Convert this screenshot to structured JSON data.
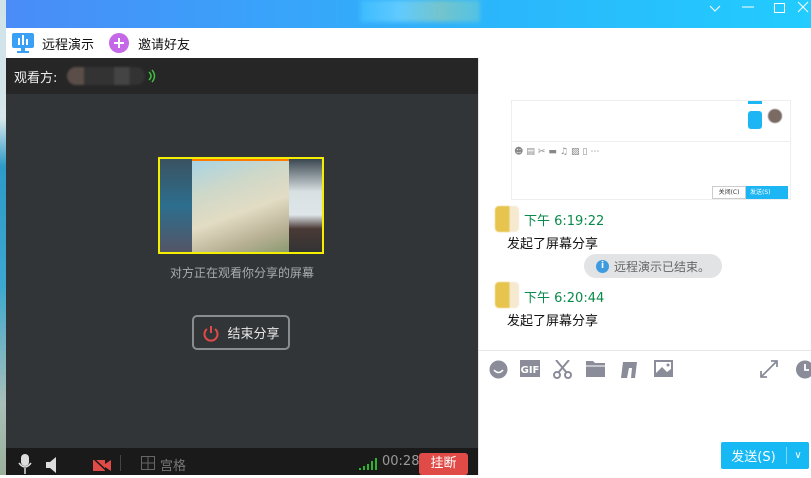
{
  "toolbar": {
    "remote_demo": "远程演示",
    "invite_friends": "邀请好友"
  },
  "call": {
    "viewer_label": "观看方:",
    "sharing_status": "对方正在观看你分享的屏幕",
    "end_share_label": "结束分享",
    "grid_label": "宫格",
    "duration": "00:28",
    "hangup_label": "挂断"
  },
  "chat": {
    "snapshot": {
      "close_label": "关闭(C)",
      "send_label": "发送(S)"
    },
    "messages": [
      {
        "time": "下午 6:19:22",
        "text": "发起了屏幕分享"
      },
      {
        "time": "下午 6:20:44",
        "text": "发起了屏幕分享"
      }
    ],
    "system_message": "远程演示已结束。",
    "send_label": "发送(S)"
  },
  "colors": {
    "accent": "#16b9f4",
    "hangup": "#e04b47",
    "time_green": "#0a8a4a",
    "titlebar_start": "#4a8cf8",
    "titlebar_end": "#22ccff"
  }
}
